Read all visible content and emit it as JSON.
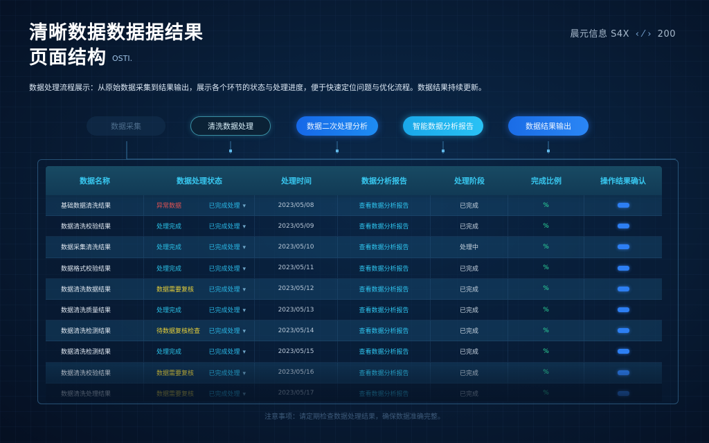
{
  "header": {
    "title_line1": "清晰数据数据据结果",
    "title_line2": "页面结构",
    "title_tag": "OSTI.",
    "brand_text": "晨元信息 S4X",
    "brand_mark": "‹ ⁄ ›",
    "brand_year": "200"
  },
  "description": "数据处理流程展示：从原始数据采集到结果输出，展示各个环节的状态与处理进度，便于快速定位问题与优化流程。数据结果持续更新。",
  "flow_steps": [
    {
      "label": "数据采集"
    },
    {
      "label": "清洗数据处理"
    },
    {
      "label": "数据二次处理分析"
    },
    {
      "label": "智能数据分析报告"
    },
    {
      "label": "数据结果输出"
    }
  ],
  "table": {
    "columns": [
      "数据名称",
      "数据处理状态",
      "处理时间",
      "数据分析报告",
      "处理阶段",
      "完成比例",
      "操作结果确认"
    ],
    "rows": [
      {
        "name": "基础数据清洗结果",
        "status": "异常数据",
        "status_color": "#e05252",
        "stage_code": "已完成处理",
        "time": "2023/05/08",
        "report": "查看数据分析报告",
        "phase": "已完成",
        "pct": "%"
      },
      {
        "name": "数据清洗校验结果",
        "status": "处理完成",
        "status_color": "#2bc4ea",
        "stage_code": "已完成处理",
        "time": "2023/05/09",
        "report": "查看数据分析报告",
        "phase": "已完成",
        "pct": "%"
      },
      {
        "name": "数据采集清洗结果",
        "status": "处理完成",
        "status_color": "#2bc4ea",
        "stage_code": "已完成处理",
        "time": "2023/05/10",
        "report": "查看数据分析报告",
        "phase": "处理中",
        "pct": "%"
      },
      {
        "name": "数据格式校验结果",
        "status": "处理完成",
        "status_color": "#2bc4ea",
        "stage_code": "已完成处理",
        "time": "2023/05/11",
        "report": "查看数据分析报告",
        "phase": "已完成",
        "pct": "%"
      },
      {
        "name": "数据清洗数据结果",
        "status": "数据需要复核",
        "status_color": "#e6cf3a",
        "stage_code": "已完成处理",
        "time": "2023/05/12",
        "report": "查看数据分析报告",
        "phase": "已完成",
        "pct": "%"
      },
      {
        "name": "数据清洗质量结果",
        "status": "处理完成",
        "status_color": "#2bc4ea",
        "stage_code": "已完成处理",
        "time": "2023/05/13",
        "report": "查看数据分析报告",
        "phase": "已完成",
        "pct": "%"
      },
      {
        "name": "数据清洗检测结果",
        "status": "待数据复核检查",
        "status_color": "#e6cf3a",
        "stage_code": "已完成处理",
        "time": "2023/05/14",
        "report": "查看数据分析报告",
        "phase": "已完成",
        "pct": "%"
      },
      {
        "name": "数据清洗检测结果",
        "status": "处理完成",
        "status_color": "#2bc4ea",
        "stage_code": "已完成处理",
        "time": "2023/05/15",
        "report": "查看数据分析报告",
        "phase": "已完成",
        "pct": "%"
      },
      {
        "name": "数据清洗校验结果",
        "status": "数据需要复核",
        "status_color": "#e6cf3a",
        "stage_code": "已完成处理",
        "time": "2023/05/16",
        "report": "查看数据分析报告",
        "phase": "已完成",
        "pct": "%"
      },
      {
        "name": "数据清洗处理结果",
        "status": "数据需要复核",
        "status_color": "#e6cf3a",
        "stage_code": "已完成处理",
        "time": "2023/05/17",
        "report": "查看数据分析报告",
        "phase": "已完成",
        "pct": "%"
      }
    ]
  },
  "footer": "注意事项：请定期检查数据处理结果，确保数据准确完整。"
}
